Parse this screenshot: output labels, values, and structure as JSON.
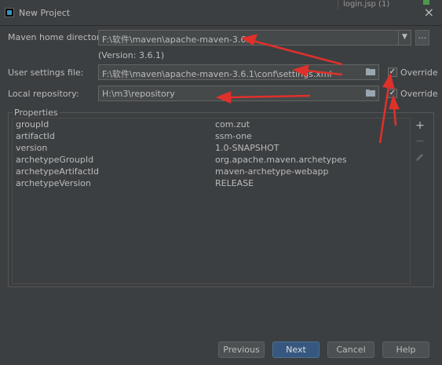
{
  "window": {
    "title": "New Project",
    "background_tab": "login.jsp (1)"
  },
  "maven_home": {
    "label": "Maven home directory:",
    "value": "F:\\软件\\maven\\apache-maven-3.6.1",
    "version": "(Version: 3.6.1)"
  },
  "settings_file": {
    "label": "User settings file:",
    "value": "F:\\软件\\maven\\apache-maven-3.6.1\\conf\\settings.xml",
    "override_label": "Override",
    "override_checked": true
  },
  "local_repo": {
    "label": "Local repository:",
    "value": "H:\\m3\\repository",
    "override_label": "Override",
    "override_checked": true
  },
  "browse_label": "...",
  "properties": {
    "title": "Properties",
    "rows": [
      {
        "key": "groupId",
        "value": "com.zut"
      },
      {
        "key": "artifactId",
        "value": "ssm-one"
      },
      {
        "key": "version",
        "value": "1.0-SNAPSHOT"
      },
      {
        "key": "archetypeGroupId",
        "value": "org.apache.maven.archetypes"
      },
      {
        "key": "archetypeArtifactId",
        "value": "maven-archetype-webapp"
      },
      {
        "key": "archetypeVersion",
        "value": "RELEASE"
      }
    ],
    "tools": {
      "add": "+",
      "remove": "−",
      "edit": "edit-icon"
    }
  },
  "buttons": {
    "previous": "Previous",
    "next": "Next",
    "cancel": "Cancel",
    "help": "Help"
  },
  "colors": {
    "background": "#3c3f41",
    "field": "#45494a",
    "primary_button": "#365880",
    "annotation_arrow": "#e0302a"
  }
}
